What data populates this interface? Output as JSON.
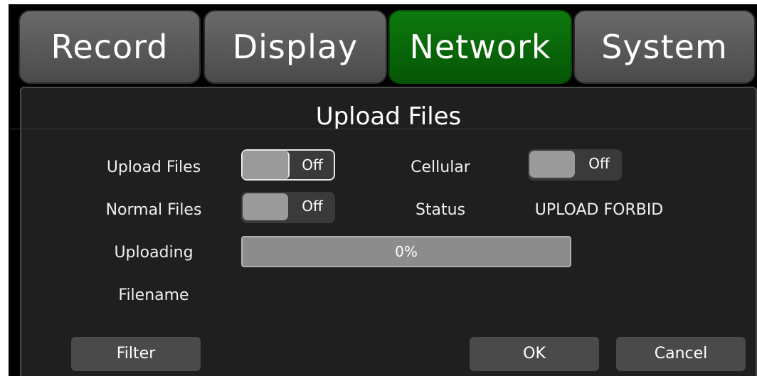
{
  "tabs": [
    {
      "label": "Record"
    },
    {
      "label": "Display"
    },
    {
      "label": "Network"
    },
    {
      "label": "System"
    }
  ],
  "active_tab": "Network",
  "panel": {
    "title": "Upload Files"
  },
  "settings": {
    "upload_files": {
      "label": "Upload Files",
      "value": "Off"
    },
    "normal_files": {
      "label": "Normal Files",
      "value": "Off"
    },
    "cellular": {
      "label": "Cellular",
      "value": "Off"
    },
    "status": {
      "label": "Status",
      "value": "UPLOAD FORBID"
    },
    "uploading": {
      "label": "Uploading",
      "value_text": "0%",
      "progress_fraction": 0
    },
    "filename": {
      "label": "Filename",
      "value": ""
    }
  },
  "buttons": {
    "filter": "Filter",
    "ok": "OK",
    "cancel": "Cancel"
  },
  "colors": {
    "active_tab": "#0a6e0a",
    "inactive_tab": "#5a5a5a",
    "panel_bg": "#1f1f1f",
    "toggle_knob": "#9a9a9a"
  }
}
